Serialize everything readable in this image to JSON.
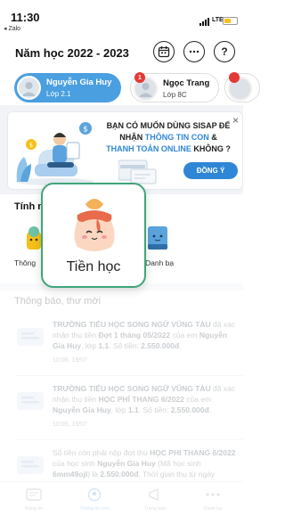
{
  "status_bar": {
    "time": "11:30",
    "back_app": "◂ Zalo",
    "network": "LTE"
  },
  "header": {
    "school_year": "Năm học 2022 - 2023"
  },
  "students": [
    {
      "name": "Nguyễn Gia Huy",
      "class": "Lớp 2.1",
      "active": true
    },
    {
      "name": "Ngọc Trang",
      "class": "Lớp 8C",
      "badge": "1"
    },
    {
      "name": "",
      "class": ""
    }
  ],
  "promo": {
    "line1": "BẠN CÓ MUỐN DÙNG SISAP ĐỂ",
    "line2_prefix": "NHẬN ",
    "line2_highlight": "THÔNG TIN CON",
    "line2_suffix": " &",
    "line3_highlight": "THANH TOÁN ONLINE",
    "line3_suffix": " KHÔNG ?",
    "button": "ĐỒNG Ý",
    "close": "×"
  },
  "quick_access": {
    "title_partial": "Tính n",
    "items": [
      {
        "label_partial": "Thông"
      },
      {
        "label_partial": "Danh bạ"
      }
    ]
  },
  "popup": {
    "label": "Tiền học"
  },
  "notifications": {
    "title": "Thông báo, thư mời",
    "items": [
      {
        "p1": "TRƯỜNG TIỂU HỌC SONG NGỮ VŨNG TÀU",
        "p2": " đã xác nhận thu tiền ",
        "p3": "Đợt 1 tháng 05/2022",
        "p4": " của em ",
        "p5": "Nguyễn Gia Huy",
        "p6": ", lớp ",
        "p7": "1.1",
        "p8": ". Số tiền: ",
        "p9": "2.550.000đ",
        "p10": ".",
        "time": "10:06, 19/07"
      },
      {
        "p1": "TRƯỜNG TIỂU HỌC SONG NGỮ VŨNG TÀU",
        "p2": " đã xác nhận thu tiền ",
        "p3": "HỌC PHÍ THANG 6/2022",
        "p4": " của em ",
        "p5": "Nguyễn Gia Huy",
        "p6": ", lớp ",
        "p7": "1.1",
        "p8": ". Số tiền: ",
        "p9": "2.550.000đ",
        "p10": ".",
        "time": "10:05, 19/07"
      },
      {
        "p1": "Số tiền còn phải nộp đợt thu ",
        "p2": "HỌC PHI THANG 6/2022",
        "p3": " của học sinh ",
        "p4": "Nguyễn Gia Huy",
        "p5": " (Mã học sinh ",
        "p6": "6mm49ojl",
        "p7": ") là ",
        "p8": "2.550.000đ",
        "p9": ". Thời gian thu từ ngày"
      }
    ]
  },
  "tabbar": {
    "tabs": [
      {
        "label": "Bảng tin"
      },
      {
        "label": "Thông tin con",
        "active": true
      },
      {
        "label": "Trang báo"
      },
      {
        "label": "Danh bạ"
      }
    ]
  },
  "colors": {
    "primary": "#2f86d6",
    "chip_active": "#4a9fe0",
    "popup_border": "#3fa57a",
    "badge": "#e53935"
  }
}
